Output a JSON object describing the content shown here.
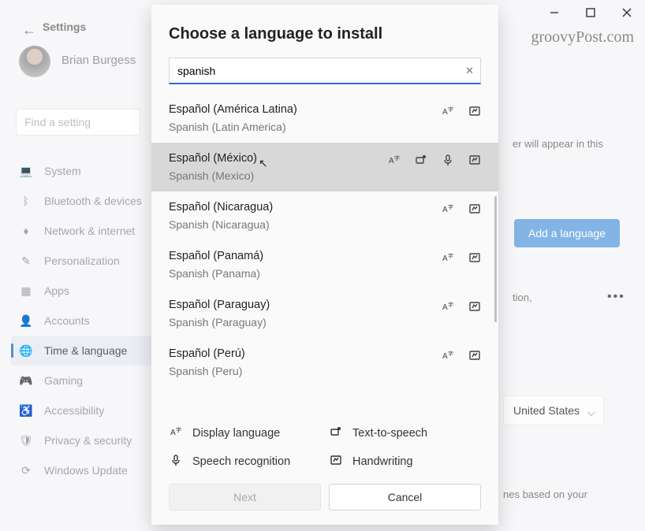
{
  "window": {
    "settings_title": "Settings",
    "username": "Brian Burgess",
    "search_placeholder": "Find a setting"
  },
  "watermark": "groovyPost.com",
  "sidebar": {
    "items": [
      {
        "label": "System",
        "icon": "💻"
      },
      {
        "label": "Bluetooth & devices",
        "icon": "ᛒ"
      },
      {
        "label": "Network & internet",
        "icon": "♦"
      },
      {
        "label": "Personalization",
        "icon": "✎"
      },
      {
        "label": "Apps",
        "icon": "▦"
      },
      {
        "label": "Accounts",
        "icon": "👤"
      },
      {
        "label": "Time & language",
        "icon": "🌐"
      },
      {
        "label": "Gaming",
        "icon": "🎮"
      },
      {
        "label": "Accessibility",
        "icon": "♿"
      },
      {
        "label": "Privacy & security",
        "icon": "🛡"
      },
      {
        "label": "Windows Update",
        "icon": "⟳"
      }
    ],
    "active_index": 6
  },
  "background": {
    "hint1": "er will appear in this",
    "add_button": "Add a language",
    "hint2": "tion,",
    "region_value": "United States",
    "hint3": "nes based on your"
  },
  "dialog": {
    "title": "Choose a language to install",
    "search_value": "spanish",
    "results": [
      {
        "primary": "Español (América Latina)",
        "secondary": "Spanish (Latin America)",
        "features": [
          "display",
          "handwriting"
        ],
        "selected": false
      },
      {
        "primary": "Español (México)",
        "secondary": "Spanish (Mexico)",
        "features": [
          "display",
          "tts",
          "speech",
          "handwriting"
        ],
        "selected": true
      },
      {
        "primary": "Español (Nicaragua)",
        "secondary": "Spanish (Nicaragua)",
        "features": [
          "display",
          "handwriting"
        ],
        "selected": false
      },
      {
        "primary": "Español (Panamá)",
        "secondary": "Spanish (Panama)",
        "features": [
          "display",
          "handwriting"
        ],
        "selected": false
      },
      {
        "primary": "Español (Paraguay)",
        "secondary": "Spanish (Paraguay)",
        "features": [
          "display",
          "handwriting"
        ],
        "selected": false
      },
      {
        "primary": "Español (Perú)",
        "secondary": "Spanish (Peru)",
        "features": [
          "display",
          "handwriting"
        ],
        "selected": false
      }
    ],
    "legend": {
      "display": "Display language",
      "tts": "Text-to-speech",
      "speech": "Speech recognition",
      "handwriting": "Handwriting"
    },
    "next_label": "Next",
    "cancel_label": "Cancel"
  }
}
